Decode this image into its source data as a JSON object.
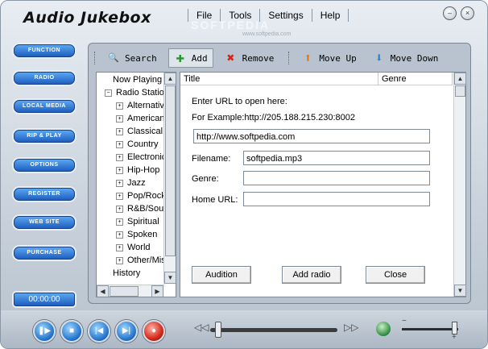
{
  "app": {
    "title": "Audio Jukebox"
  },
  "menu": [
    "File",
    "Tools",
    "Settings",
    "Help"
  ],
  "watermark": {
    "main": "SOFTPEDIA",
    "sub": "www.softpedia.com"
  },
  "window_buttons": {
    "minimize": "–",
    "close": "×"
  },
  "sidebar": {
    "buttons": [
      "FUNCTION",
      "RADIO",
      "LOCAL MEDIA",
      "RIP & PLAY",
      "OPTIONS",
      "REGISTER",
      "WEB SITE",
      "PURCHASE"
    ],
    "time": "00:00:00"
  },
  "toolbar": {
    "search": "Search",
    "add": "Add",
    "remove": "Remove",
    "move_up": "Move Up",
    "move_down": "Move Down"
  },
  "tree": {
    "now_playing": "Now Playing",
    "radio_stations": "Radio Stations",
    "genres": [
      "Alternative",
      "American",
      "Classical",
      "Country",
      "Electronic",
      "Hip-Hop",
      "Jazz",
      "Pop/Rock",
      "R&B/Soul",
      "Spiritual",
      "Spoken",
      "World",
      "Other/Misc"
    ],
    "history": "History"
  },
  "list": {
    "columns": [
      "Title",
      "Genre"
    ]
  },
  "dialog": {
    "prompt": "Enter URL to open here:",
    "example": "For Example:http://205.188.215.230:8002",
    "url_value": "http://www.softpedia.com",
    "filename_label": "Filename:",
    "filename_value": "softpedia.mp3",
    "genre_label": "Genre:",
    "genre_value": "",
    "homeurl_label": "Home URL:",
    "homeurl_value": "",
    "buttons": {
      "audition": "Audition",
      "add_radio": "Add radio",
      "close": "Close"
    }
  },
  "transport": {
    "seek_back": "◁◁",
    "seek_fwd": "▷▷"
  },
  "colors": {
    "accent": "#1f5fc0",
    "panel": "#b9c3cf"
  }
}
